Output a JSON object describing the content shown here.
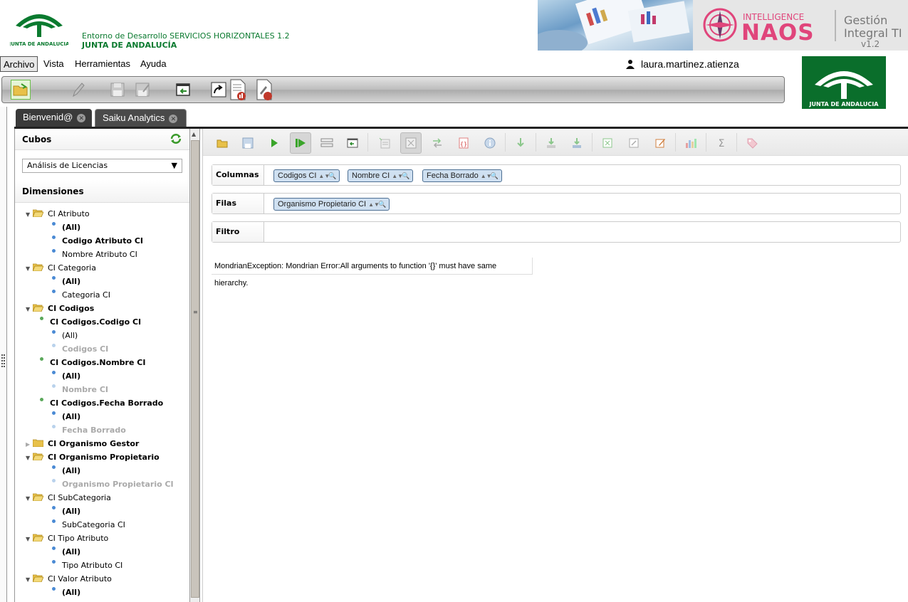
{
  "header": {
    "env_text": "Entorno de Desarrollo SERVICIOS HORIZONTALES 1.2",
    "org_text": "JUNTA DE ANDALUCÍA",
    "logo_text": "JUNTA DE ANDALUCIA",
    "brand_intelligence": "INTELLIGENCE",
    "brand_naos": "NAOS",
    "brand_gestion": "Gestión",
    "brand_integral": "Integral TI",
    "brand_version": "v1.2"
  },
  "menu": {
    "archivo": "Archivo",
    "vista": "Vista",
    "herramientas": "Herramientas",
    "ayuda": "Ayuda"
  },
  "user": {
    "name": "laura.martinez.atienza"
  },
  "tabs": [
    {
      "label": "Bienvenid@"
    },
    {
      "label": "Saiku Analytics"
    }
  ],
  "sidebar": {
    "cubos_title": "Cubos",
    "cube_selected": "Análisis de Licencias",
    "dimensiones_title": "Dimensiones",
    "tree": [
      {
        "label": "CI Atributo",
        "kind": "folder"
      },
      {
        "label": "(All)",
        "kind": "level-bold"
      },
      {
        "label": "Codigo Atributo CI",
        "kind": "level-bold"
      },
      {
        "label": "Nombre Atributo CI",
        "kind": "level"
      },
      {
        "label": "CI Categoria",
        "kind": "folder"
      },
      {
        "label": "(All)",
        "kind": "level-bold"
      },
      {
        "label": "Categoria CI",
        "kind": "level"
      },
      {
        "label": "CI Codigos",
        "kind": "folder-bold"
      },
      {
        "label": "CI Codigos.Codigo CI",
        "kind": "hier"
      },
      {
        "label": "(All)",
        "kind": "level"
      },
      {
        "label": "Codigos CI",
        "kind": "level-grey"
      },
      {
        "label": "CI Codigos.Nombre CI",
        "kind": "hier"
      },
      {
        "label": "(All)",
        "kind": "level-bold"
      },
      {
        "label": "Nombre CI",
        "kind": "level-grey"
      },
      {
        "label": "CI Codigos.Fecha Borrado",
        "kind": "hier"
      },
      {
        "label": "(All)",
        "kind": "level-bold"
      },
      {
        "label": "Fecha Borrado",
        "kind": "level-grey"
      },
      {
        "label": "CI Organismo Gestor",
        "kind": "folder-closed"
      },
      {
        "label": "CI Organismo Propietario",
        "kind": "folder-bold"
      },
      {
        "label": "(All)",
        "kind": "level-bold"
      },
      {
        "label": "Organismo Propietario CI",
        "kind": "level-grey"
      },
      {
        "label": "CI SubCategoria",
        "kind": "folder"
      },
      {
        "label": "(All)",
        "kind": "level-bold"
      },
      {
        "label": "SubCategoria CI",
        "kind": "level"
      },
      {
        "label": "CI Tipo Atributo",
        "kind": "folder"
      },
      {
        "label": "(All)",
        "kind": "level-bold"
      },
      {
        "label": "Tipo Atributo CI",
        "kind": "level"
      },
      {
        "label": "CI Valor Atributo",
        "kind": "folder"
      },
      {
        "label": "(All)",
        "kind": "level-bold"
      }
    ]
  },
  "workspace": {
    "columnas_label": "Columnas",
    "filas_label": "Filas",
    "filtro_label": "Filtro",
    "columns": [
      "Codigos CI",
      "Nombre CI",
      "Fecha Borrado"
    ],
    "rows": [
      "Organismo Propietario CI"
    ],
    "error": "MondrianException: Mondrian Error:All arguments to function '{}' must have same hierarchy."
  },
  "colors": {
    "brand_green": "#0a7a2f",
    "tab_bg": "#3a3a3a",
    "chip_bg": "#cfe0f1",
    "naos_pink": "#e0457b"
  }
}
